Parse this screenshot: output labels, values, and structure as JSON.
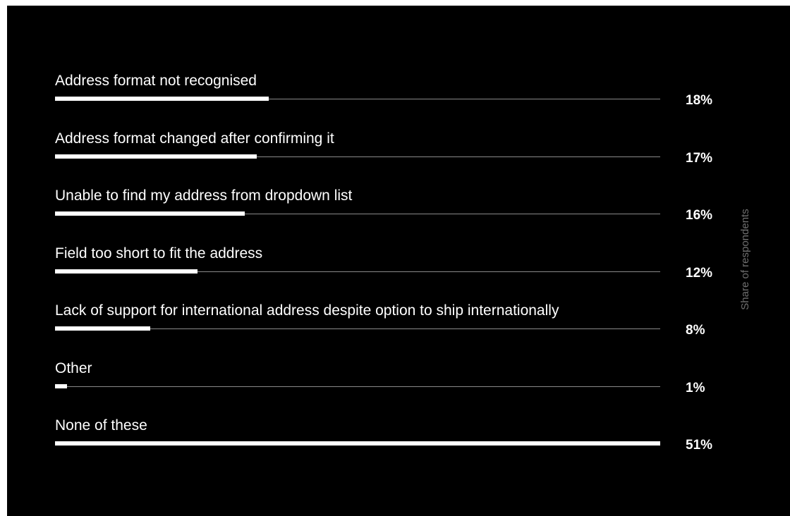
{
  "chart_data": {
    "type": "bar",
    "orientation": "horizontal",
    "categories": [
      "Address format not recognised",
      "Address format changed after confirming it",
      "Unable to find my address from dropdown list",
      "Field too short to fit the address",
      "Lack of support for international address despite option to ship internationally",
      "Other",
      "None of these"
    ],
    "values": [
      18,
      17,
      16,
      12,
      8,
      1,
      51
    ],
    "value_labels": [
      "18%",
      "17%",
      "16%",
      "12%",
      "8%",
      "1%",
      "51%"
    ],
    "unit": "%",
    "ylabel": "Share of respondents",
    "xlim": [
      0,
      51
    ],
    "grid": false,
    "legend": "none",
    "colors": {
      "background": "#000000",
      "bar": "#ffffff",
      "track": "#8a8a8a",
      "axis_title": "#6f6f6f"
    }
  }
}
